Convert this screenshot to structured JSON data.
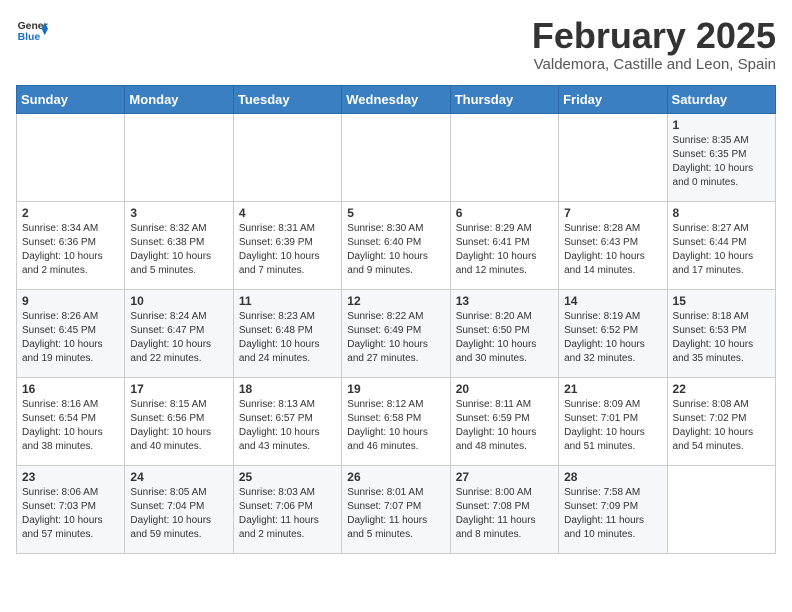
{
  "header": {
    "logo_general": "General",
    "logo_blue": "Blue",
    "title": "February 2025",
    "subtitle": "Valdemora, Castille and Leon, Spain"
  },
  "weekdays": [
    "Sunday",
    "Monday",
    "Tuesday",
    "Wednesday",
    "Thursday",
    "Friday",
    "Saturday"
  ],
  "weeks": [
    [
      {
        "day": "",
        "info": ""
      },
      {
        "day": "",
        "info": ""
      },
      {
        "day": "",
        "info": ""
      },
      {
        "day": "",
        "info": ""
      },
      {
        "day": "",
        "info": ""
      },
      {
        "day": "",
        "info": ""
      },
      {
        "day": "1",
        "info": "Sunrise: 8:35 AM\nSunset: 6:35 PM\nDaylight: 10 hours and 0 minutes."
      }
    ],
    [
      {
        "day": "2",
        "info": "Sunrise: 8:34 AM\nSunset: 6:36 PM\nDaylight: 10 hours and 2 minutes."
      },
      {
        "day": "3",
        "info": "Sunrise: 8:32 AM\nSunset: 6:38 PM\nDaylight: 10 hours and 5 minutes."
      },
      {
        "day": "4",
        "info": "Sunrise: 8:31 AM\nSunset: 6:39 PM\nDaylight: 10 hours and 7 minutes."
      },
      {
        "day": "5",
        "info": "Sunrise: 8:30 AM\nSunset: 6:40 PM\nDaylight: 10 hours and 9 minutes."
      },
      {
        "day": "6",
        "info": "Sunrise: 8:29 AM\nSunset: 6:41 PM\nDaylight: 10 hours and 12 minutes."
      },
      {
        "day": "7",
        "info": "Sunrise: 8:28 AM\nSunset: 6:43 PM\nDaylight: 10 hours and 14 minutes."
      },
      {
        "day": "8",
        "info": "Sunrise: 8:27 AM\nSunset: 6:44 PM\nDaylight: 10 hours and 17 minutes."
      }
    ],
    [
      {
        "day": "9",
        "info": "Sunrise: 8:26 AM\nSunset: 6:45 PM\nDaylight: 10 hours and 19 minutes."
      },
      {
        "day": "10",
        "info": "Sunrise: 8:24 AM\nSunset: 6:47 PM\nDaylight: 10 hours and 22 minutes."
      },
      {
        "day": "11",
        "info": "Sunrise: 8:23 AM\nSunset: 6:48 PM\nDaylight: 10 hours and 24 minutes."
      },
      {
        "day": "12",
        "info": "Sunrise: 8:22 AM\nSunset: 6:49 PM\nDaylight: 10 hours and 27 minutes."
      },
      {
        "day": "13",
        "info": "Sunrise: 8:20 AM\nSunset: 6:50 PM\nDaylight: 10 hours and 30 minutes."
      },
      {
        "day": "14",
        "info": "Sunrise: 8:19 AM\nSunset: 6:52 PM\nDaylight: 10 hours and 32 minutes."
      },
      {
        "day": "15",
        "info": "Sunrise: 8:18 AM\nSunset: 6:53 PM\nDaylight: 10 hours and 35 minutes."
      }
    ],
    [
      {
        "day": "16",
        "info": "Sunrise: 8:16 AM\nSunset: 6:54 PM\nDaylight: 10 hours and 38 minutes."
      },
      {
        "day": "17",
        "info": "Sunrise: 8:15 AM\nSunset: 6:56 PM\nDaylight: 10 hours and 40 minutes."
      },
      {
        "day": "18",
        "info": "Sunrise: 8:13 AM\nSunset: 6:57 PM\nDaylight: 10 hours and 43 minutes."
      },
      {
        "day": "19",
        "info": "Sunrise: 8:12 AM\nSunset: 6:58 PM\nDaylight: 10 hours and 46 minutes."
      },
      {
        "day": "20",
        "info": "Sunrise: 8:11 AM\nSunset: 6:59 PM\nDaylight: 10 hours and 48 minutes."
      },
      {
        "day": "21",
        "info": "Sunrise: 8:09 AM\nSunset: 7:01 PM\nDaylight: 10 hours and 51 minutes."
      },
      {
        "day": "22",
        "info": "Sunrise: 8:08 AM\nSunset: 7:02 PM\nDaylight: 10 hours and 54 minutes."
      }
    ],
    [
      {
        "day": "23",
        "info": "Sunrise: 8:06 AM\nSunset: 7:03 PM\nDaylight: 10 hours and 57 minutes."
      },
      {
        "day": "24",
        "info": "Sunrise: 8:05 AM\nSunset: 7:04 PM\nDaylight: 10 hours and 59 minutes."
      },
      {
        "day": "25",
        "info": "Sunrise: 8:03 AM\nSunset: 7:06 PM\nDaylight: 11 hours and 2 minutes."
      },
      {
        "day": "26",
        "info": "Sunrise: 8:01 AM\nSunset: 7:07 PM\nDaylight: 11 hours and 5 minutes."
      },
      {
        "day": "27",
        "info": "Sunrise: 8:00 AM\nSunset: 7:08 PM\nDaylight: 11 hours and 8 minutes."
      },
      {
        "day": "28",
        "info": "Sunrise: 7:58 AM\nSunset: 7:09 PM\nDaylight: 11 hours and 10 minutes."
      },
      {
        "day": "",
        "info": ""
      }
    ]
  ]
}
